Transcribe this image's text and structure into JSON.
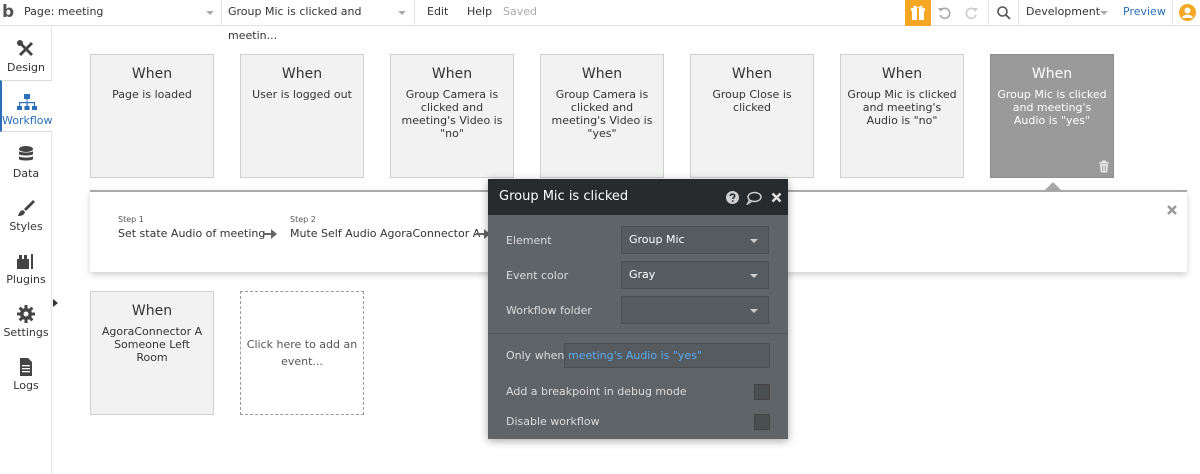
{
  "topbar": {
    "logo": "b",
    "page_selector": "Page: meeting",
    "event_selector": "Group Mic is clicked and meetin...",
    "menu_edit": "Edit",
    "menu_help": "Help",
    "save_status": "Saved",
    "environment": "Development",
    "preview": "Preview"
  },
  "sidebar": {
    "items": [
      {
        "label": "Design"
      },
      {
        "label": "Workflow"
      },
      {
        "label": "Data"
      },
      {
        "label": "Styles"
      },
      {
        "label": "Plugins"
      },
      {
        "label": "Settings"
      },
      {
        "label": "Logs"
      }
    ]
  },
  "events": [
    {
      "when": "When",
      "condition": "Page is loaded"
    },
    {
      "when": "When",
      "condition": "User is logged out"
    },
    {
      "when": "When",
      "condition": "Group Camera is clicked and meeting's Video is \"no\""
    },
    {
      "when": "When",
      "condition": "Group Camera is clicked and meeting's Video is \"yes\""
    },
    {
      "when": "When",
      "condition": "Group Close is clicked"
    },
    {
      "when": "When",
      "condition": "Group Mic is clicked and meeting's Audio is \"no\""
    },
    {
      "when": "When",
      "condition": "Group Mic is clicked and meeting's Audio is \"yes\""
    },
    {
      "when": "When",
      "condition": "AgoraConnector A Someone Left Room"
    }
  ],
  "add_event": {
    "text": "Click here to add an event..."
  },
  "steps": [
    {
      "label": "Step 1",
      "title": "Set state Audio of meeting"
    },
    {
      "label": "Step 2",
      "title": "Mute Self Audio AgoraConnector A"
    }
  ],
  "editor": {
    "title": "Group Mic is clicked",
    "element_label": "Element",
    "element_value": "Group Mic",
    "color_label": "Event color",
    "color_value": "Gray",
    "folder_label": "Workflow folder",
    "folder_value": "",
    "only_when_label": "Only when",
    "only_when_value": "meeting's Audio is \"yes\"",
    "breakpoint_label": "Add a breakpoint in debug mode",
    "disable_label": "Disable workflow"
  },
  "colors": {
    "accent": "#2a6fb8",
    "gift": "#f5a623",
    "editor_bg": "#5f6468",
    "editor_header": "#272b2d",
    "expression": "#5aa9f0"
  }
}
